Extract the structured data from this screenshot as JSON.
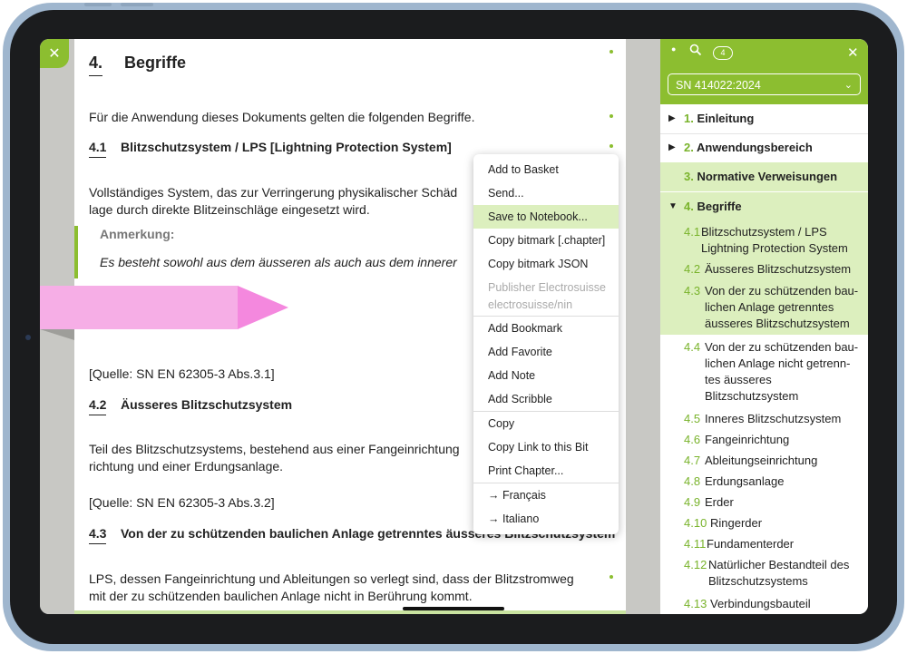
{
  "document": {
    "section_num": "4.",
    "section_title": "Begriffe",
    "intro": "Für die Anwendung dieses Dokuments gelten die folgenden Begriffe.",
    "term1_num": "4.1",
    "term1_title": "Blitzschutzsystem / LPS [Lightning Protection System]",
    "term1_def_l1": "Vollständiges System, das zur Verringerung physikalischer Schäd",
    "term1_def_l2": "lage durch direkte Blitzeinschläge eingesetzt wird.",
    "note_label": "Anmerkung:",
    "note_text": "Es besteht sowohl aus dem äusseren als auch aus dem innerer",
    "source1": "[Quelle: SN EN 62305-3 Abs.3.1]",
    "term2_num": "4.2",
    "term2_title": "Äusseres Blitzschutzsystem",
    "term2_def_l1": "Teil des Blitzschutzsystems, bestehend aus einer Fangeinrichtung",
    "term2_def_l2": "richtung und einer Erdungsanlage.",
    "source2": "[Quelle: SN EN 62305-3 Abs.3.2]",
    "term3_num": "4.3",
    "term3_title": "Von der zu schützenden baulichen Anlage getrenntes äusseres Blitzschutzsystem",
    "term3_def_l1": "LPS, dessen Fangeinrichtung und Ableitungen so verlegt sind, dass der Blitzstromweg",
    "term3_def_l2": "mit der zu schützenden baulichen Anlage nicht in Berührung kommt."
  },
  "context_menu": {
    "items": [
      {
        "label": "Add to Basket"
      },
      {
        "label": "Send..."
      },
      {
        "label": "Save to Notebook..."
      },
      {
        "label": "Copy bitmark [.chapter]"
      },
      {
        "label": "Copy bitmark JSON"
      },
      {
        "label": "Publisher Electrosuisse",
        "label2": "electrosuisse/nin"
      },
      {
        "label": "Add Bookmark"
      },
      {
        "label": "Add Favorite"
      },
      {
        "label": "Add Note"
      },
      {
        "label": "Add Scribble"
      },
      {
        "label": "Copy"
      },
      {
        "label": "Copy Link to this Bit"
      },
      {
        "label": "Print Chapter..."
      },
      {
        "label": "→ Français"
      },
      {
        "label": "→ Italiano"
      }
    ]
  },
  "sidebar": {
    "badge": "4",
    "selected_doc": "SN 414022:2024",
    "toc": [
      {
        "num": "1.",
        "label": "Einleitung"
      },
      {
        "num": "2.",
        "label": "Anwendungsbereich"
      },
      {
        "num": "3.",
        "label": "Normative Verweisungen"
      },
      {
        "num": "4.",
        "label": "Begriffe"
      },
      {
        "num": "4.1",
        "l1": "Blitzschutzsystem / LPS",
        "l2": "Lightning Protection System"
      },
      {
        "num": "4.2",
        "label": "Äusseres Blitzschutzsystem"
      },
      {
        "num": "4.3",
        "l1": "Von der zu schützenden bau-",
        "l2": "lichen Anlage getrenntes",
        "l3": "äusseres Blitzschutzsystem"
      },
      {
        "num": "4.4",
        "l1": "Von der zu schützenden bau-",
        "l2": "lichen Anlage nicht getrenn-",
        "l3": "tes äusseres",
        "l4": "Blitzschutzsystem"
      },
      {
        "num": "4.5",
        "label": "Inneres Blitzschutzsystem"
      },
      {
        "num": "4.6",
        "label": "Fangeinrichtung"
      },
      {
        "num": "4.7",
        "label": "Ableitungseinrichtung"
      },
      {
        "num": "4.8",
        "label": "Erdungsanlage"
      },
      {
        "num": "4.9",
        "label": "Erder"
      },
      {
        "num": "4.10",
        "label": "Ringerder"
      },
      {
        "num": "4.11",
        "label": "Fundamenterder"
      },
      {
        "num": "4.12",
        "l1": "Natürlicher Bestandteil des",
        "l2": "Blitzschutzsystems"
      },
      {
        "num": "4.13",
        "label": "Verbindungsbauteil"
      }
    ]
  },
  "colors": {
    "accent": "#8cbe30",
    "highlight": "#dcefbe",
    "bookmark": "#f6aee6"
  }
}
